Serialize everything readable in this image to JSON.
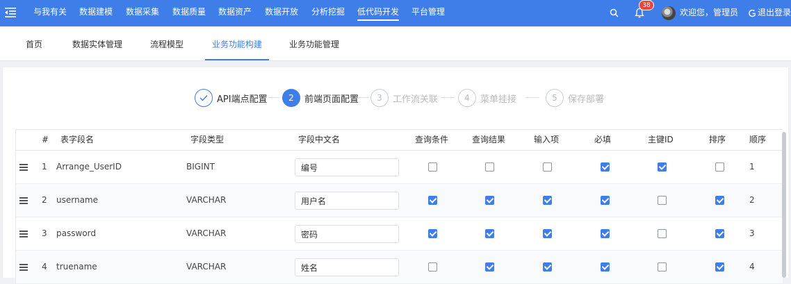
{
  "topnav": {
    "items": [
      {
        "label": "与我有关"
      },
      {
        "label": "数据建模"
      },
      {
        "label": "数据采集"
      },
      {
        "label": "数据质量"
      },
      {
        "label": "数据资产"
      },
      {
        "label": "数据开放"
      },
      {
        "label": "分析挖掘"
      },
      {
        "label": "低代码开发"
      },
      {
        "label": "平台管理"
      }
    ],
    "active_index": 7,
    "notification_count": "38",
    "welcome": "欢迎您，管理员",
    "logout": "退出登录",
    "accent_color": "#3f7ee8"
  },
  "subnav": {
    "tabs": [
      {
        "label": "首页"
      },
      {
        "label": "数据实体管理"
      },
      {
        "label": "流程模型"
      },
      {
        "label": "业务功能构建"
      },
      {
        "label": "业务功能管理"
      }
    ],
    "active_index": 3
  },
  "steps": [
    {
      "number": "1",
      "label": "API端点配置",
      "state": "done"
    },
    {
      "number": "2",
      "label": "前端页面配置",
      "state": "active"
    },
    {
      "number": "3",
      "label": "工作流关联",
      "state": "pending"
    },
    {
      "number": "4",
      "label": "菜单挂接",
      "state": "pending"
    },
    {
      "number": "5",
      "label": "保存部署",
      "state": "pending"
    }
  ],
  "table": {
    "headers": {
      "index": "#",
      "field_name": "表字段名",
      "field_type": "字段类型",
      "cn_name": "字段中文名",
      "query_condition": "查询条件",
      "query_result": "查询结果",
      "input_item": "输入项",
      "required": "必填",
      "primary_key": "主键ID",
      "sort": "排序",
      "order": "顺序"
    },
    "rows": [
      {
        "index": "1",
        "field_name": "Arrange_UserID",
        "field_type": "BIGINT",
        "cn_name": "编号",
        "query_condition": false,
        "query_result": false,
        "input_item": false,
        "required": true,
        "primary_key": true,
        "sort": false,
        "order": "1"
      },
      {
        "index": "2",
        "field_name": "username",
        "field_type": "VARCHAR",
        "cn_name": "用户名",
        "query_condition": true,
        "query_result": true,
        "input_item": true,
        "required": true,
        "primary_key": false,
        "sort": true,
        "order": "2"
      },
      {
        "index": "3",
        "field_name": "password",
        "field_type": "VARCHAR",
        "cn_name": "密码",
        "query_condition": true,
        "query_result": true,
        "input_item": true,
        "required": true,
        "primary_key": false,
        "sort": true,
        "order": "3"
      },
      {
        "index": "4",
        "field_name": "truename",
        "field_type": "VARCHAR",
        "cn_name": "姓名",
        "query_condition": false,
        "query_result": true,
        "input_item": true,
        "required": true,
        "primary_key": false,
        "sort": true,
        "order": "4"
      }
    ]
  }
}
